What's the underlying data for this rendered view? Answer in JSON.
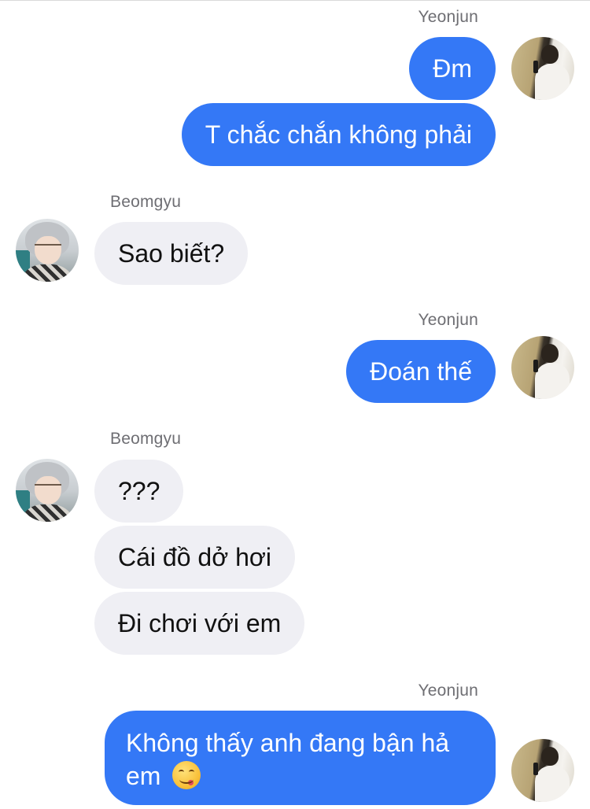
{
  "chat": {
    "groups": [
      {
        "sender": "Yeonjun",
        "messages": [
          "Đm",
          "T chắc chắn không phải"
        ]
      },
      {
        "sender": "Beomgyu",
        "messages": [
          "Sao biết?"
        ]
      },
      {
        "sender": "Yeonjun",
        "messages": [
          "Đoán thế"
        ]
      },
      {
        "sender": "Beomgyu",
        "messages": [
          "???",
          "Cái đồ dở hơi",
          "Đi chơi với em"
        ]
      },
      {
        "sender": "Yeonjun",
        "messages": [
          "Không thấy anh đang bận hả em"
        ],
        "emoji": "yum-face-emoji"
      }
    ]
  },
  "colors": {
    "outgoing_bubble": "#3478f6",
    "incoming_bubble": "#efeff4",
    "sender_name": "#6e6e73"
  },
  "icons": {
    "yeonjun_avatar": "avatar-photo",
    "beomgyu_avatar": "avatar-photo"
  }
}
